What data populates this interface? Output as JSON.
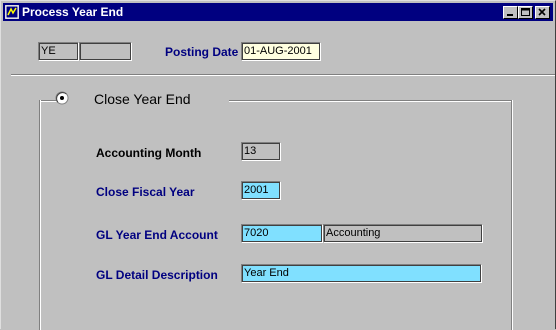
{
  "window": {
    "title": "Process Year End",
    "icon": "oracle-forms-icon",
    "buttons": [
      "minimize",
      "maximize",
      "close"
    ]
  },
  "header": {
    "code_value": "YE",
    "code2_value": "",
    "posting_date_label": "Posting Date",
    "posting_date_value": "01-AUG-2001"
  },
  "group": {
    "title": "Close Year End",
    "radio_selected": true
  },
  "fields": {
    "accounting_month_label": "Accounting Month",
    "accounting_month_value": "13",
    "close_fiscal_year_label": "Close Fiscal Year",
    "close_fiscal_year_value": "2001",
    "gl_year_end_account_label": "GL Year End Account",
    "gl_year_end_account_value": "7020",
    "gl_year_end_account_desc": "Accounting",
    "gl_detail_description_label": "GL Detail Description",
    "gl_detail_description_value": "Year End"
  },
  "colors": {
    "titlebar": "#000080",
    "window_bg": "#c0c0c0",
    "required_field": "#80e0ff",
    "focused_field": "#ffffe0",
    "label_blue": "#000080"
  }
}
